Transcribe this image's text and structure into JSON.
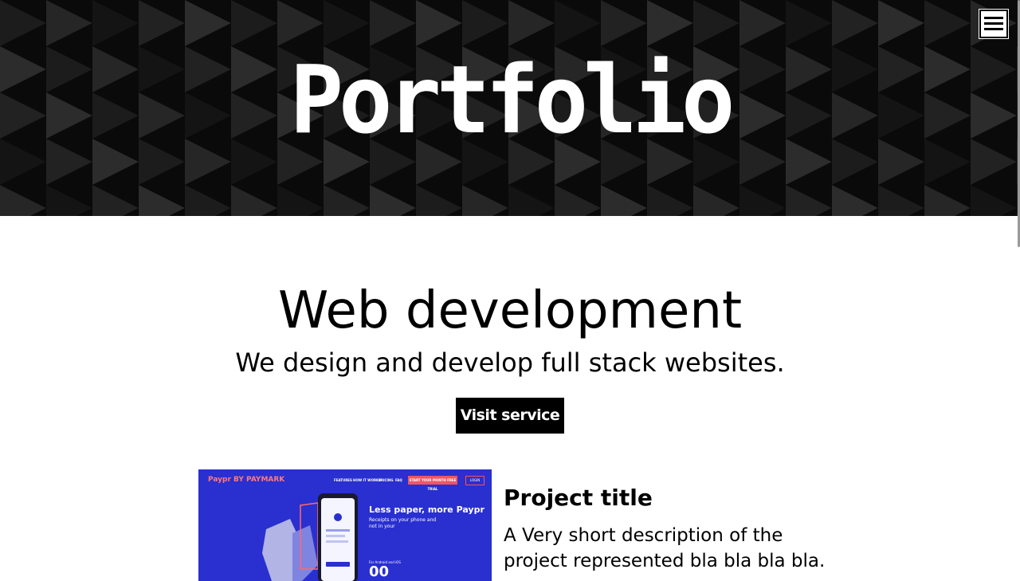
{
  "header": {
    "title": "Portfolio",
    "menu_icon": "hamburger-menu-icon",
    "background_color": "#0a0a0a"
  },
  "service": {
    "title": "Web development",
    "subtitle": "We design and develop full stack websites.",
    "button_label": "Visit service"
  },
  "project": {
    "title": "Project title",
    "description": "A Very short description of the project represented bla bla bla bla.",
    "thumbnail": {
      "logo": "Paypr BY PAYMARK",
      "nav_items": [
        "FEATURES",
        "HOW IT WORKS",
        "PRICING",
        "FAQ"
      ],
      "cta": "START YOUR MONTH FREE TRIAL",
      "login": "LOGIN",
      "headline": "Less paper, more Paypr",
      "subtext": "Receipts on your phone and not in your",
      "small_text": "For Android and iOS",
      "big_text": "00",
      "background_color": "#2a2fd0"
    }
  }
}
